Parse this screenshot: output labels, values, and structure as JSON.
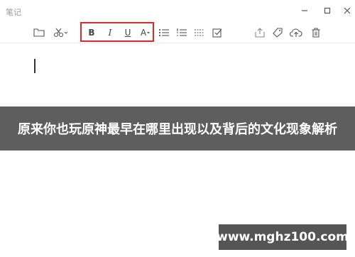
{
  "window": {
    "title": "笔记",
    "minimize_icon": "minimize-icon",
    "maximize_icon": "maximize-icon",
    "close_icon": "close-icon"
  },
  "toolbar": {
    "icons": [
      "folder-icon",
      "cut-icon",
      "bold-icon",
      "italic-icon",
      "underline-icon",
      "font-color-icon",
      "bullet-list-icon",
      "numbered-list-icon",
      "dashed-line-icon",
      "checkbox-icon",
      "share-icon",
      "tag-icon",
      "cloud-upload-icon",
      "trash-icon"
    ],
    "bold_label": "B",
    "italic_label": "I",
    "underline_label": "U",
    "font_color_label": "A"
  },
  "highlight_color": "#e3262b",
  "overlay": {
    "banner_text": "原来你也玩原神最早在哪里出现以及背后的文化现象解析",
    "watermark_text": "www.mghz100.com"
  }
}
